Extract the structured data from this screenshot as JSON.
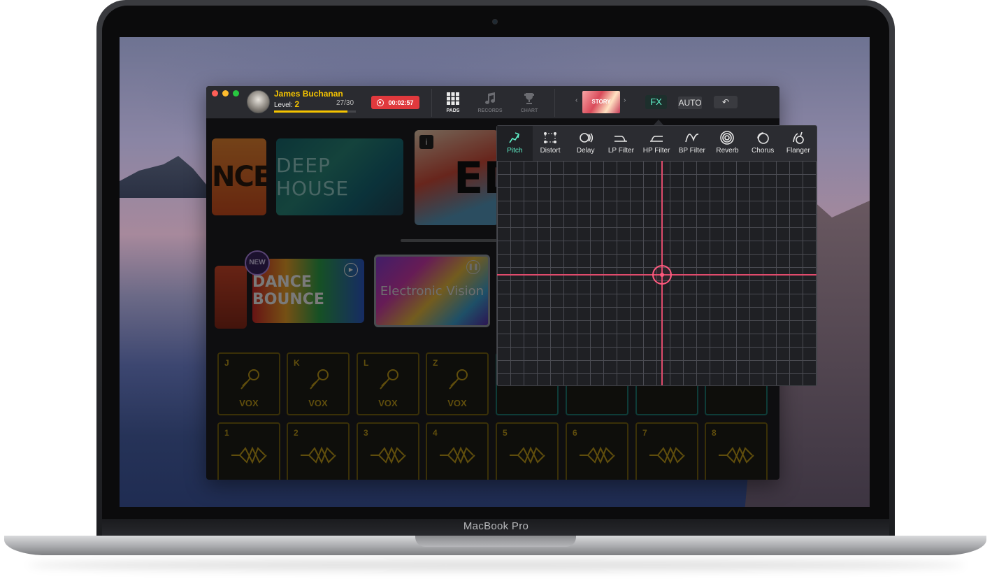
{
  "device": {
    "label": "MacBook Pro"
  },
  "user": {
    "name": "James Buchanan",
    "level_label": "Level:",
    "level_value": "2",
    "xp": "27/30",
    "xp_fraction": 0.9
  },
  "record": {
    "time": "00:02:57"
  },
  "nav": {
    "pads": "PADS",
    "records": "RECORDS",
    "chart": "CHART"
  },
  "song": {
    "thumb_text": "STORY",
    "prev": "‹",
    "next": "›"
  },
  "toolbar": {
    "fx": "FX",
    "auto": "AUTO",
    "undo": "↶"
  },
  "packs": {
    "nce": "NCE",
    "deep_house": "DEEP HOUSE",
    "edm": "ED",
    "info": "i",
    "dance_bounce": "DANCE BOUNCE",
    "new_badge": "NEW",
    "electronic_vision": "Electronic Vision"
  },
  "pads_row1": [
    {
      "key": "J",
      "label": "VOX"
    },
    {
      "key": "K",
      "label": "VOX"
    },
    {
      "key": "L",
      "label": "VOX"
    },
    {
      "key": "Z",
      "label": "VOX"
    }
  ],
  "pads_row2": [
    "1",
    "2",
    "3",
    "4",
    "5",
    "6",
    "7",
    "8"
  ],
  "fx": {
    "tabs": [
      "Pitch",
      "Distort",
      "Delay",
      "LP Filter",
      "HP Filter",
      "BP Filter",
      "Reverb",
      "Chorus",
      "Flanger"
    ],
    "active_tab": "Pitch",
    "colors": {
      "accent": "#5ff0c8",
      "crosshair": "#e04b6c"
    }
  }
}
